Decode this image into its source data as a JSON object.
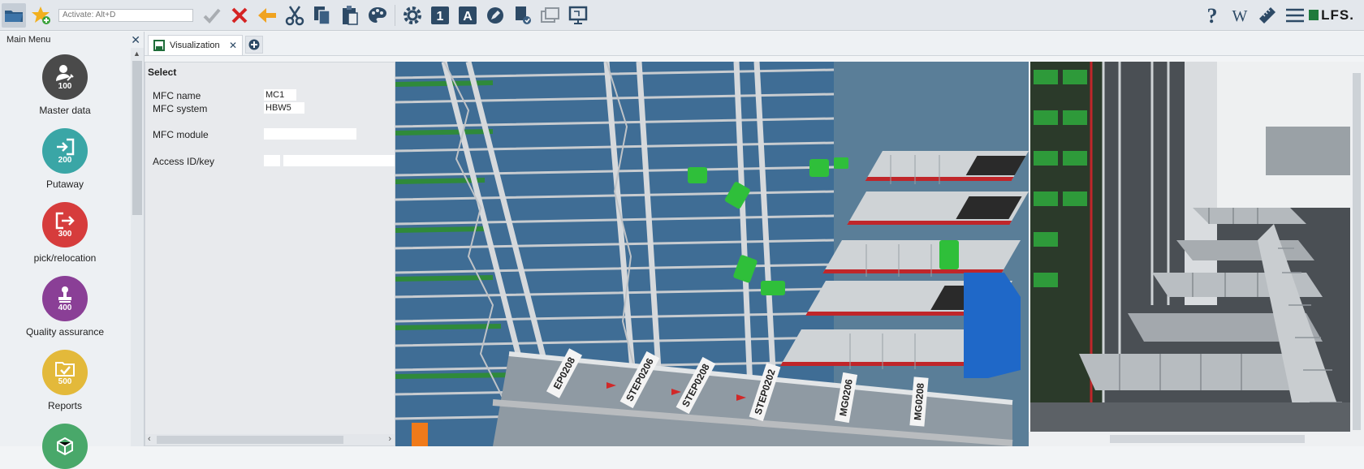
{
  "toolbar": {
    "command_placeholder": "Activate: Alt+D",
    "logo_text": "LFS."
  },
  "sidebar": {
    "title": "Main Menu",
    "items": [
      {
        "code": "100",
        "label": "Master data",
        "color": "#4a4a4a"
      },
      {
        "code": "200",
        "label": "Putaway",
        "color": "#3aa6a6"
      },
      {
        "code": "300",
        "label": "pick/relocation",
        "color": "#d63c3c"
      },
      {
        "code": "400",
        "label": "Quality assurance",
        "color": "#8a3f96"
      },
      {
        "code": "500",
        "label": "Reports",
        "color": "#e3b93a"
      },
      {
        "code": "",
        "label": "",
        "color": "#49a86a"
      }
    ]
  },
  "tabs": [
    {
      "label": "Visualization"
    }
  ],
  "form": {
    "title": "Select",
    "fields": {
      "mfc_name": {
        "label": "MFC name",
        "value": "MC1"
      },
      "mfc_system": {
        "label": "MFC system",
        "value": "HBW5"
      },
      "mfc_module": {
        "label": "MFC module",
        "value": ""
      },
      "access_id": {
        "label": "Access ID/key",
        "value": ""
      }
    }
  },
  "visualization": {
    "labels": [
      "EP0208",
      "STEP0206",
      "STEP0208",
      "STEP0202",
      "MG0206",
      "MG0208"
    ]
  },
  "colors": {
    "accent_green": "#2fbf3a",
    "rail_red": "#c0262a",
    "steel": "#b9bcbf"
  }
}
